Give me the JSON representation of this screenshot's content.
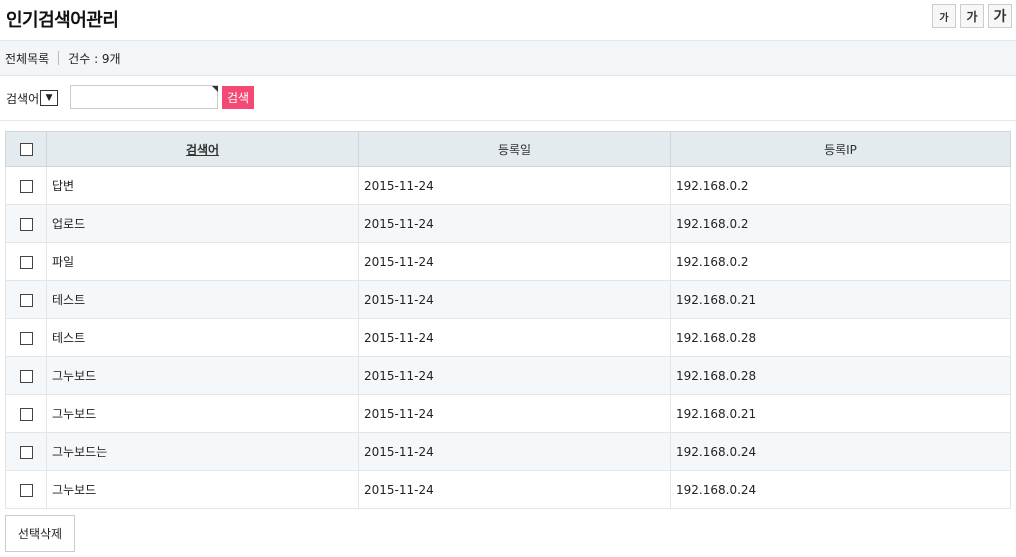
{
  "page": {
    "title": "인기검색어관리"
  },
  "font_buttons": {
    "small": "가",
    "medium": "가",
    "large": "가"
  },
  "summary": {
    "all_list": "전체목록",
    "count_label": "건수 : 9개"
  },
  "search": {
    "field_label": "검색어",
    "input_value": "",
    "button_label": "검색"
  },
  "table": {
    "headers": {
      "word": "검색어",
      "date": "등록일",
      "ip": "등록IP"
    },
    "rows": [
      {
        "word": "답변",
        "date": "2015-11-24",
        "ip": "192.168.0.2"
      },
      {
        "word": "업로드",
        "date": "2015-11-24",
        "ip": "192.168.0.2"
      },
      {
        "word": "파일",
        "date": "2015-11-24",
        "ip": "192.168.0.2"
      },
      {
        "word": "테스트",
        "date": "2015-11-24",
        "ip": "192.168.0.21"
      },
      {
        "word": "테스트",
        "date": "2015-11-24",
        "ip": "192.168.0.28"
      },
      {
        "word": "그누보드",
        "date": "2015-11-24",
        "ip": "192.168.0.28"
      },
      {
        "word": "그누보드",
        "date": "2015-11-24",
        "ip": "192.168.0.21"
      },
      {
        "word": "그누보드는",
        "date": "2015-11-24",
        "ip": "192.168.0.24"
      },
      {
        "word": "그누보드",
        "date": "2015-11-24",
        "ip": "192.168.0.24"
      }
    ]
  },
  "actions": {
    "delete_selected": "선택삭제"
  },
  "colors": {
    "accent": "#f44875",
    "header_bg": "#e4ebef",
    "summary_bg": "#f3f6f9"
  }
}
